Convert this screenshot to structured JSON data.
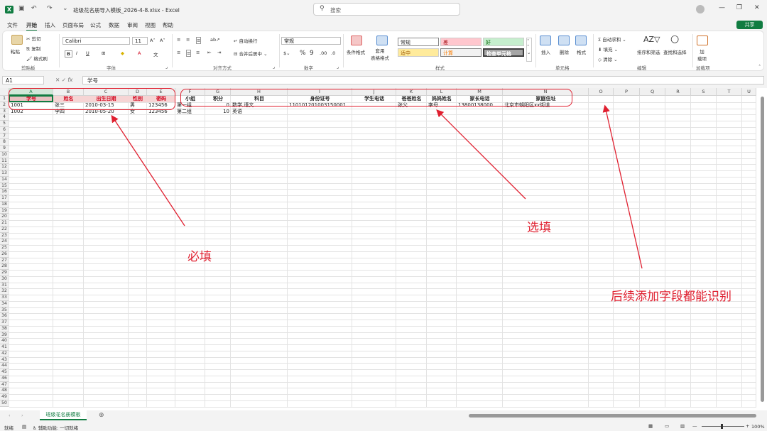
{
  "titlebar": {
    "file_title": "班级花名册导入模板_2026-4-8.xlsx  -  Excel",
    "search_placeholder": "搜索"
  },
  "tabs": [
    "文件",
    "开始",
    "插入",
    "页面布局",
    "公式",
    "数据",
    "审阅",
    "视图",
    "帮助"
  ],
  "share_label": "共享",
  "ribbon": {
    "clipboard": {
      "paste": "粘贴",
      "cut": "剪切",
      "copy": "复制",
      "format_painter": "格式刷",
      "label": "剪贴板"
    },
    "font": {
      "name": "Calibri",
      "size": "11",
      "label": "字体",
      "bold": "B",
      "italic": "I",
      "underline": "U"
    },
    "alignment": {
      "wrap": "自动换行",
      "merge": "合并后居中",
      "label": "对齐方式"
    },
    "number": {
      "format": "常规",
      "label": "数字"
    },
    "styles": {
      "cond": "条件格式",
      "table": "套用\n表格格式",
      "normal": "常规",
      "bad": "差",
      "good": "好",
      "neutral": "适中",
      "calc": "计算",
      "check": "检查单元格",
      "label": "样式"
    },
    "cells": {
      "insert": "插入",
      "delete": "删除",
      "format": "格式",
      "label": "单元格"
    },
    "editing": {
      "autosum": "自动求和",
      "fill": "填充",
      "clear": "清除",
      "sort": "排序和筛选",
      "find": "查找和选择",
      "label": "编辑"
    },
    "addins": {
      "addins": "加\n载项",
      "label": "加载项"
    }
  },
  "formula": {
    "namebox": "A1",
    "value": "学号"
  },
  "columns": [
    "A",
    "B",
    "C",
    "D",
    "E",
    "F",
    "G",
    "H",
    "I",
    "J",
    "K",
    "L",
    "M",
    "N",
    "O",
    "P",
    "Q",
    "R",
    "S",
    "T",
    "U"
  ],
  "headers": [
    "学号",
    "姓名",
    "出生日期",
    "性别",
    "密码",
    "小组",
    "积分",
    "科目",
    "身份证号",
    "学生电话",
    "爸爸姓名",
    "妈妈姓名",
    "家长电话",
    "家庭住址"
  ],
  "rows": [
    [
      "1001",
      "张三",
      "2010-03-15",
      "男",
      "123456",
      "第一组",
      "0",
      "数学,语文",
      "110101201003150001",
      "",
      "张父",
      "李母",
      "13800138000",
      "北京市朝阳区xx街道"
    ],
    [
      "1002",
      "李四",
      "2010-05-20",
      "女",
      "123456",
      "第二组",
      "10",
      "英语",
      "",
      "",
      "",
      "",
      "",
      ""
    ]
  ],
  "annotations": {
    "required": "必填",
    "optional": "选填",
    "extensible": "后续添加字段都能识别"
  },
  "sheet_tab": "班级花名册模板",
  "status": {
    "ready": "就绪",
    "accessibility": "辅助功能: 一切就绪",
    "zoom": "100%"
  },
  "colors": {
    "accent": "#107c41",
    "annotation": "#e02030"
  }
}
